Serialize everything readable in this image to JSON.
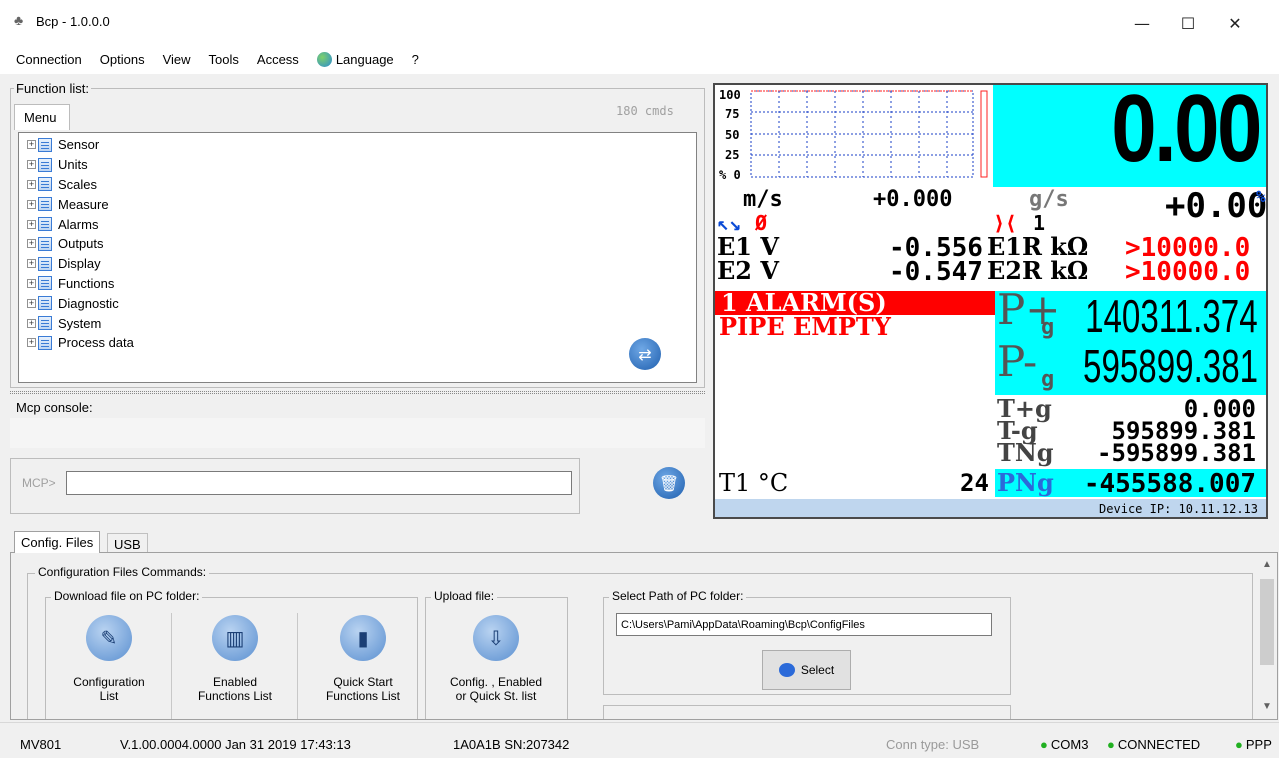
{
  "window": {
    "title": "Bcp - 1.0.0.0",
    "minimize": "—",
    "maximize": "☐",
    "close": "✕"
  },
  "menu": [
    "Connection",
    "Options",
    "View",
    "Tools",
    "Access",
    "Language",
    "?"
  ],
  "function_list": {
    "title": "Function list:",
    "tab": "Menu",
    "count": "180 cmds",
    "items": [
      "Sensor",
      "Units",
      "Scales",
      "Measure",
      "Alarms",
      "Outputs",
      "Display",
      "Functions",
      "Diagnostic",
      "System",
      "Process data"
    ]
  },
  "console": {
    "title": "Mcp console:",
    "prompt": "MCP>",
    "input_value": ""
  },
  "display": {
    "big_value": "0.00",
    "graph_ticks": [
      "100",
      "75",
      "50",
      "25",
      "% 0"
    ],
    "flow_unit": "m/s",
    "flow_value": "+0.000",
    "rate_unit": "g/s",
    "rate_value": "+0.00",
    "rate_suffix": "%",
    "rate_count": "1",
    "arrows": "↖↘",
    "empty_symbol": "Ø",
    "cross_symbol": "⟩⟨",
    "e1_label": "E1  V",
    "e1_value": "-0.556",
    "e1r_label": "E1R  kΩ",
    "e1r_value": ">10000.0",
    "e2_label": "E2  V",
    "e2_value": "-0.547",
    "e2r_label": "E2R  kΩ",
    "e2r_value": ">10000.0",
    "alarm": "1 ALARM(S)",
    "alarm_msg": "PIPE EMPTY",
    "p_plus_label": "P+",
    "p_plus_unit": "g",
    "p_plus_value": "140311.374",
    "p_minus_label": "P-",
    "p_minus_unit": "g",
    "p_minus_value": "595899.381",
    "t_plus_label": "T+g",
    "t_plus_value": "0.000",
    "t_minus_label": "T-g",
    "t_minus_value": "595899.381",
    "tn_label": "TNg",
    "tn_value": "-595899.381",
    "t1_label": "T1  °C",
    "t1_value": "24",
    "pn_label": "PNg",
    "pn_value": "-455588.007",
    "device_ip": "Device IP: 10.11.12.13"
  },
  "bottom_tabs": [
    "Config. Files",
    "USB"
  ],
  "config": {
    "group_title": "Configuration Files Commands:",
    "download_title": "Download file on PC folder:",
    "upload_title": "Upload file:",
    "path_title": "Select Path of PC folder:",
    "path_value": "C:\\Users\\Pami\\AppData\\Roaming\\Bcp\\ConfigFiles",
    "select_label": "Select",
    "buttons": [
      {
        "line1": "Configuration",
        "line2": "List"
      },
      {
        "line1": "Enabled",
        "line2": "Functions List"
      },
      {
        "line1": "Quick Start",
        "line2": "Functions List"
      },
      {
        "line1": "Config. , Enabled",
        "line2": "or Quick St. list"
      }
    ]
  },
  "status": {
    "model": "MV801",
    "version": "V.1.00.0004.0000 Jan 31 2019   17:43:13",
    "serial": "1A0A1B SN:207342",
    "conn_type": "Conn type: USB",
    "port": "COM3",
    "state": "CONNECTED",
    "proto": "PPP"
  },
  "colors": {
    "lcd_cyan": "#00ffff",
    "lcd_red": "#ff0000",
    "lcd_blue": "#0a4ad6",
    "status_green": "#21b021"
  }
}
